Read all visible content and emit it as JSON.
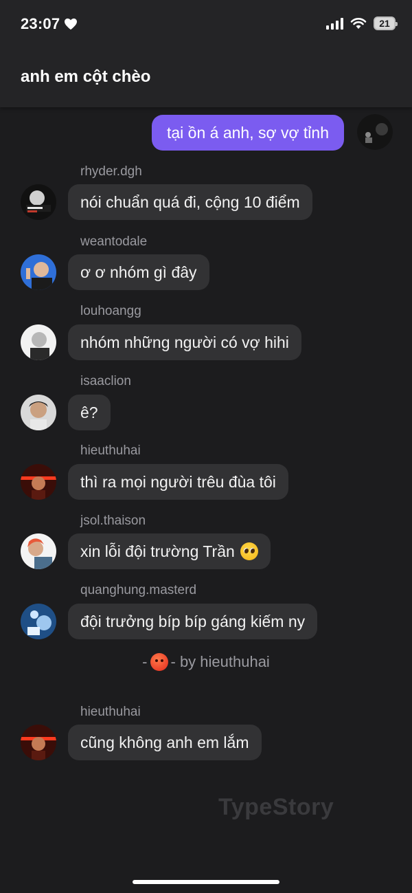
{
  "status_bar": {
    "time": "23:07",
    "battery": "21"
  },
  "header": {
    "title": "anh em cột chèo"
  },
  "own_message": {
    "text": "tại ồn á anh, sợ vợ tỉnh"
  },
  "messages": [
    {
      "sender": "rhyder.dgh",
      "text": "nói chuẩn quá đi, cộng 10 điểm"
    },
    {
      "sender": "weantodale",
      "text": "ơ ơ nhóm gì đây"
    },
    {
      "sender": "louhoangg",
      "text": "nhóm những người có vợ hihi"
    },
    {
      "sender": "isaaclion",
      "text": "ê?"
    },
    {
      "sender": "hieuthuhai",
      "text": "thì ra mọi người trêu đùa tôi"
    },
    {
      "sender": "jsol.thaison",
      "text": "xin lỗi đội trường Trần"
    },
    {
      "sender": "quanghung.masterd",
      "text": "đội trưởng bíp bíp gáng kiếm ny"
    },
    {
      "sender": "hieuthuhai",
      "text": "cũng không anh em lắm"
    }
  ],
  "system_notice": {
    "prefix": "-",
    "suffix": "- by hieuthuhai",
    "icon": "angry-face-emoji"
  },
  "watermark": "TypeStory",
  "colors": {
    "own_bubble": "#7b5cf0",
    "bubble": "#323234",
    "background": "#1c1c1e"
  }
}
